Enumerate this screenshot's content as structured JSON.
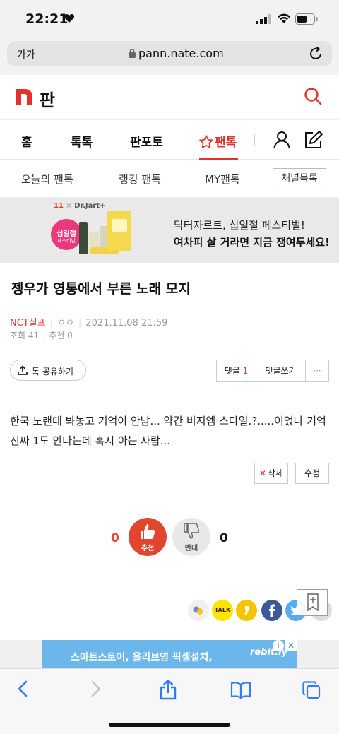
{
  "status_bar": {
    "time": "22:21"
  },
  "address_bar": {
    "text_size_label": "가가",
    "url": "pann.nate.com"
  },
  "site": {
    "logo_text": "판"
  },
  "main_nav": {
    "tabs": [
      "홈",
      "톡톡",
      "판포토",
      "팬톡"
    ],
    "active": "팬톡"
  },
  "sub_nav": {
    "items": [
      "오늘의 팬톡",
      "랭킹 팬톡",
      "MY팬톡"
    ],
    "channel_button": "채널목록"
  },
  "banner": {
    "brand": "11",
    "brand_partner": "Dr.Jart+",
    "line1": "닥터자르트, 십일절 페스티벌!",
    "line2": "여차피 살 거라면 지금 쟁여두세요!",
    "badge_line1": "십일절",
    "badge_line2": "페스티벌"
  },
  "article": {
    "title": "젱우가 영통에서 부른 노래 모지",
    "category": "NCT칠프",
    "author": "ㅇㅇ",
    "datetime": "2021.11.08 21:59",
    "views_label": "조회",
    "views": "41",
    "recommend_label": "추천",
    "recommend": "0",
    "share_label": "톡 공유하기",
    "comments_label": "댓글",
    "comments_count": "1",
    "write_comment_label": "댓글쓰기",
    "more_label": "···",
    "body_line1": "한국 노랜데 봐놓고 기억이 안남... 약간 비지엠 스타일.?.....이었나 기억",
    "body_line2": "진짜 1도 안나는데 혹시 아는 사람...",
    "delete_label": "삭제",
    "edit_label": "수정"
  },
  "vote": {
    "up_count": "0",
    "up_label": "추천",
    "down_count": "0",
    "down_label": "반대"
  },
  "social": {
    "kakaotalk_label": "TALK"
  },
  "ad": {
    "text": "스마트스토어, 올리브영 픽셀설치,",
    "logo": "rebit.ly"
  },
  "colors": {
    "accent": "#e4312b",
    "vote_up": "#e4452f",
    "facebook": "#3b5998",
    "kakao": "#fee500",
    "twitter": "#55acee"
  }
}
